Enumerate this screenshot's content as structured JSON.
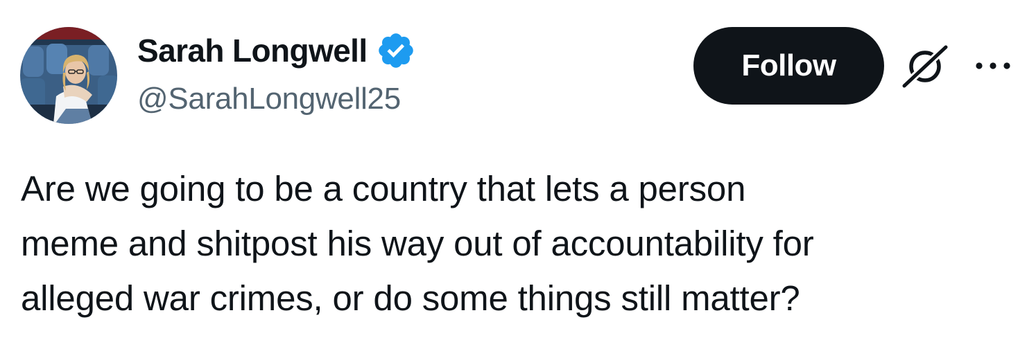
{
  "author": {
    "display_name": "Sarah Longwell",
    "handle": "@SarahLongwell25",
    "verified": true,
    "verified_color": "#1d9bf0"
  },
  "actions": {
    "follow_label": "Follow",
    "grok_icon": "grok-icon",
    "more_icon": "more-horizontal-icon"
  },
  "tweet": {
    "lines": [
      "Are we going to be a country that lets a person",
      "meme and shitpost his way out of accountability for",
      "alleged war crimes, or do some things still matter?"
    ]
  },
  "colors": {
    "text_primary": "#0f1419",
    "text_secondary": "#536471",
    "button_bg": "#0f1419",
    "button_text": "#ffffff"
  }
}
